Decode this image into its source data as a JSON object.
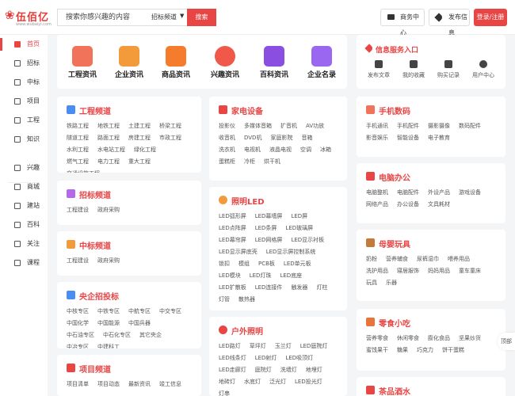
{
  "header": {
    "logo_text": "伍佰亿",
    "logo_sub": "www.wubaiyi.com",
    "search_placeholder": "搜索你感兴趣的内容",
    "search_channel": "招标频道",
    "search_button": "搜索",
    "business_center": "商务中心",
    "publish_info": "发布信息",
    "login": "登录/注册"
  },
  "sidebar": {
    "items": [
      {
        "label": "首页",
        "icon": "home-icon"
      },
      {
        "label": "招标",
        "icon": "bid-icon"
      },
      {
        "label": "中标",
        "icon": "award-icon"
      },
      {
        "label": "项目",
        "icon": "project-icon"
      },
      {
        "label": "工程",
        "icon": "engineering-icon"
      },
      {
        "label": "知识",
        "icon": "knowledge-icon"
      },
      {
        "label": "兴趣",
        "icon": "interest-icon"
      },
      {
        "label": "商城",
        "icon": "mall-icon"
      },
      {
        "label": "建站",
        "icon": "site-icon"
      },
      {
        "label": "百科",
        "icon": "wiki-icon"
      },
      {
        "label": "关注",
        "icon": "follow-icon"
      },
      {
        "label": "课程",
        "icon": "course-icon"
      }
    ]
  },
  "topnav": {
    "items": [
      {
        "label": "工程资讯",
        "color": "#f0735a"
      },
      {
        "label": "企业资讯",
        "color": "#f39a3b"
      },
      {
        "label": "商品资讯",
        "color": "#f57c2c"
      },
      {
        "label": "兴趣资讯",
        "color": "#f0584a"
      },
      {
        "label": "百科资讯",
        "color": "#8a4fe0"
      },
      {
        "label": "企业名录",
        "color": "#9a68f0"
      }
    ]
  },
  "infosvc": {
    "title": "信息服务入口",
    "items": [
      "发布文章",
      "我的收藏",
      "购买记录",
      "用户中心"
    ]
  },
  "cards": {
    "engineering": {
      "title": "工程频道",
      "links": [
        "铁路工程",
        "地铁工程",
        "土建工程",
        "桥梁工程",
        "隧道工程",
        "路面工程",
        "房建工程",
        "市政工程",
        "水利工程",
        "水电站工程",
        "绿化工程",
        "燃气工程",
        "电力工程",
        "重大工程",
        "交通设施工程"
      ]
    },
    "bidding": {
      "title": "招标频道",
      "links": [
        "工程建设",
        "政府采购"
      ]
    },
    "winning": {
      "title": "中标频道",
      "links": [
        "工程建设",
        "政府采购"
      ]
    },
    "central": {
      "title": "央企招投标",
      "links": [
        "中核专区",
        "中铁专区",
        "中航专区",
        "中交专区",
        "中国化学",
        "中国能源",
        "中国兵器",
        "中石油专区",
        "中石化专区",
        "其它央企",
        "中冶专区",
        "中建科工"
      ]
    },
    "projects": {
      "title": "项目频道",
      "links": [
        "项目清单",
        "项目动态",
        "最新资讯",
        "竣工信息"
      ]
    },
    "appliances": {
      "title": "家电设备",
      "links": [
        "投影仪",
        "多媒体音箱",
        "扩音机",
        "AV功放",
        "收音机",
        "DVD机",
        "家庭影院",
        "音箱",
        "洗衣机",
        "电视机",
        "液晶电视",
        "空调",
        "冰箱",
        "蛋糕柜",
        "冷柜",
        "烘干机"
      ]
    },
    "led": {
      "title": "照明LED",
      "links": [
        "LED弧形屏",
        "LED幕墙屏",
        "LED屏",
        "LED点阵屏",
        "LED条屏",
        "LED玻璃屏",
        "LED幕帘屏",
        "LED网格屏",
        "LED显示衬板",
        "LED显示屏底壳",
        "LED显示屏控制系统",
        "锁扣",
        "模组",
        "PCB板",
        "LED单元板",
        "LED模块",
        "LED灯珠",
        "LED底座",
        "LED扩散板",
        "LED连接件",
        "触发器",
        "灯柱",
        "灯管",
        "散热器"
      ]
    },
    "outdoor": {
      "title": "户外照明",
      "links": [
        "LED路灯",
        "草坪灯",
        "玉兰灯",
        "LED庭院灯",
        "LED线条灯",
        "LED射灯",
        "LED吸顶灯",
        "LED走廊灯",
        "庭院灯",
        "洗墙灯",
        "地埋灯",
        "地砖灯",
        "水底灯",
        "泛光灯",
        "LED投光灯",
        "灯串"
      ]
    },
    "phones": {
      "title": "手机数码",
      "links": [
        "手机通讯",
        "手机配件",
        "摄影摄像",
        "数码配件",
        "影音娱乐",
        "智能设备",
        "电子教育"
      ]
    },
    "office": {
      "title": "电脑办公",
      "links": [
        "电脑整机",
        "电脑配件",
        "外设产品",
        "游戏设备",
        "网络产品",
        "办公设备",
        "文具耗材"
      ]
    },
    "baby": {
      "title": "母婴玩具",
      "links": [
        "奶粉",
        "营养辅食",
        "尿裤湿巾",
        "喂养用品",
        "洗护用品",
        "寝居服饰",
        "妈妈用品",
        "童车童床",
        "玩具",
        "乐器"
      ]
    },
    "snacks": {
      "title": "零食小吃",
      "links": [
        "营养零食",
        "休闲零食",
        "膨化食品",
        "坚果炒货",
        "蜜饯果干",
        "糖果",
        "巧克力",
        "饼干蛋糕"
      ]
    },
    "tea": {
      "title": "茶品酒水",
      "links": []
    }
  },
  "backtop": "顶部",
  "colors": {
    "accent": "#e84545"
  }
}
